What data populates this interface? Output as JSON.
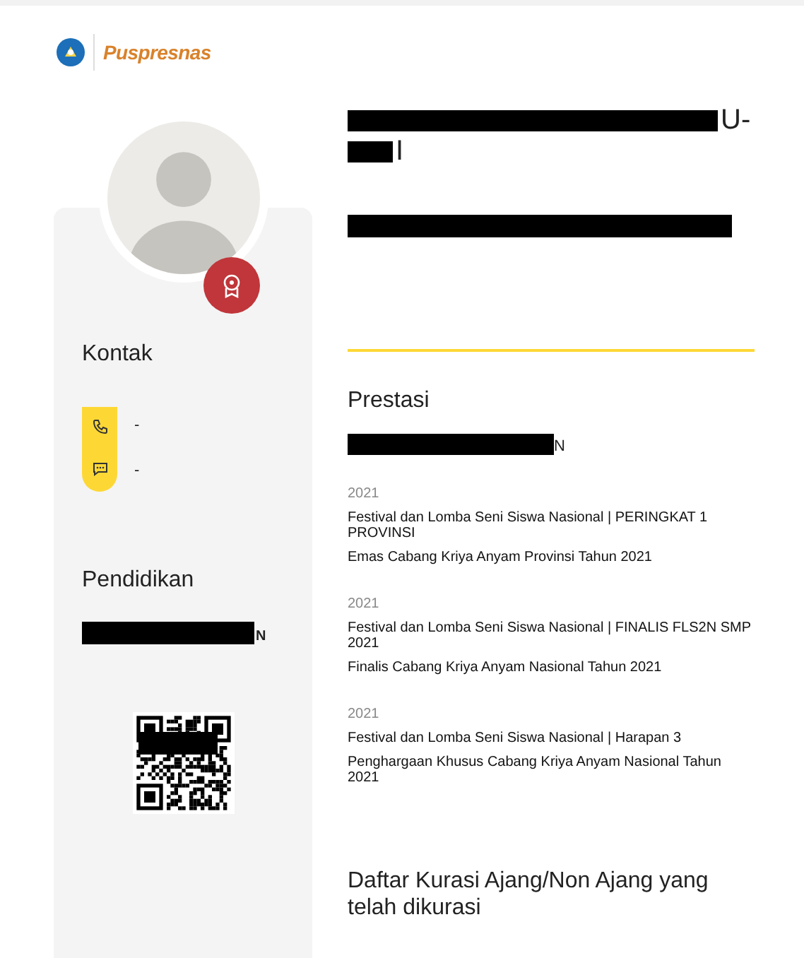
{
  "header": {
    "logo_text": "Puspresnas"
  },
  "profile": {
    "name_lines": [
      {
        "visible_tail": "U-"
      },
      {
        "visible_tail": "I"
      }
    ],
    "subtitle_redacted": true
  },
  "contact": {
    "title": "Kontak",
    "items": [
      {
        "kind": "phone",
        "value": "-"
      },
      {
        "kind": "chat",
        "value": "-"
      }
    ]
  },
  "education": {
    "title": "Pendidikan",
    "visible_tail": "N"
  },
  "achievements": {
    "title": "Prestasi",
    "school_visible_tail": "N",
    "items": [
      {
        "year": "2021",
        "event": "Festival dan Lomba Seni Siswa Nasional | PERINGKAT 1 PROVINSI",
        "award": "Emas Cabang Kriya Anyam Provinsi Tahun 2021"
      },
      {
        "year": "2021",
        "event": "Festival dan Lomba Seni Siswa Nasional | FINALIS FLS2N SMP 2021",
        "award": "Finalis Cabang Kriya Anyam Nasional Tahun 2021"
      },
      {
        "year": "2021",
        "event": "Festival dan Lomba Seni Siswa Nasional | Harapan 3",
        "award": "Penghargaan Khusus Cabang Kriya Anyam Nasional Tahun 2021"
      }
    ]
  },
  "curation": {
    "title": "Daftar Kurasi Ajang/Non Ajang yang telah dikurasi"
  }
}
